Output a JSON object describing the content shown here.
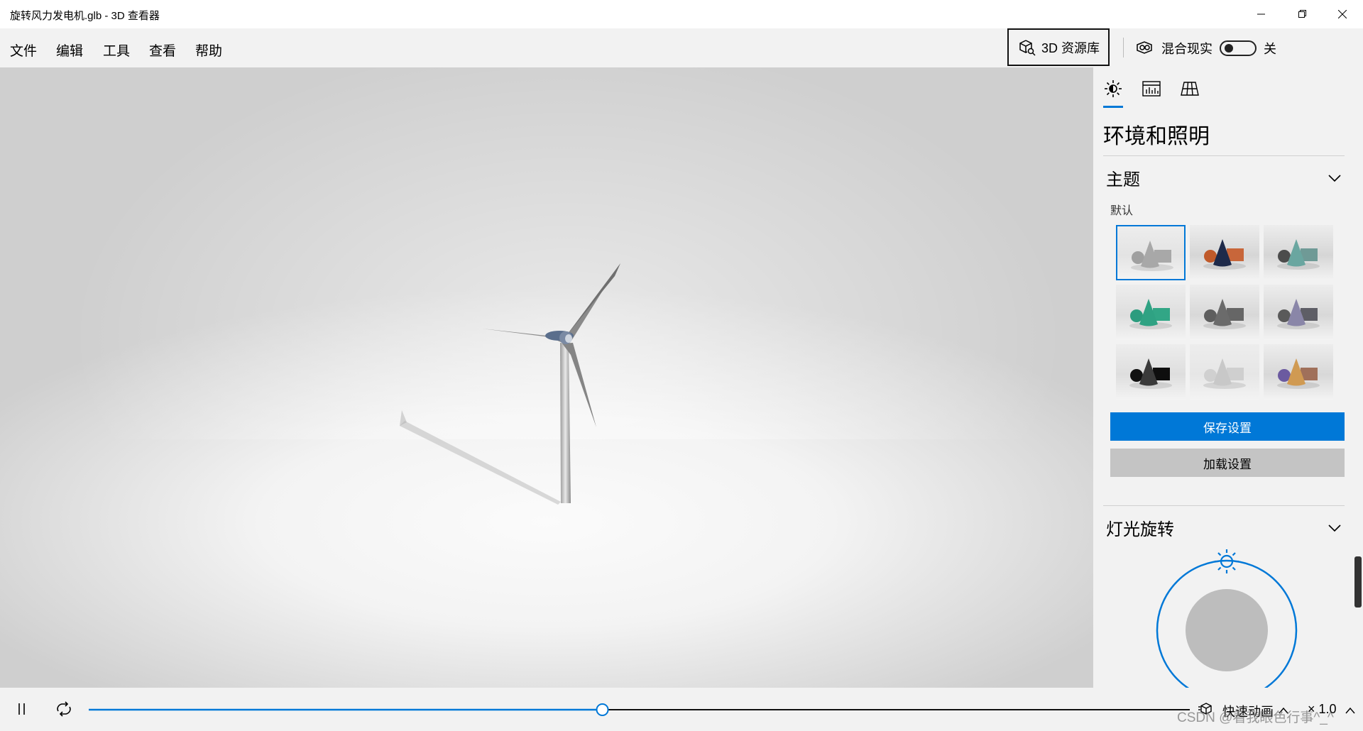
{
  "window": {
    "title": "旋转风力发电机.glb - 3D 查看器"
  },
  "menu": {
    "items": [
      "文件",
      "编辑",
      "工具",
      "查看",
      "帮助"
    ]
  },
  "toolbar": {
    "library_label": "3D 资源库",
    "mixed_reality_label": "混合现实",
    "mixed_reality_state": "关"
  },
  "panel": {
    "tabs": [
      "environment-lighting",
      "stats",
      "grid"
    ],
    "title": "环境和照明",
    "theme": {
      "heading": "主题",
      "selected_label": "默认",
      "themes": [
        {
          "cone": "#a8a8a8",
          "sphere": "#a0a0a0",
          "box": "#a8a8a8",
          "bg": "#e3e3e3",
          "selected": true
        },
        {
          "cone": "#1e2a4a",
          "sphere": "#c05a2a",
          "box": "#c8663a",
          "bg": "#d6d6d6",
          "selected": false
        },
        {
          "cone": "#6aa6a0",
          "sphere": "#4c4c4c",
          "box": "#6f9a96",
          "bg": "#d6d6d6",
          "selected": false
        },
        {
          "cone": "#2fa283",
          "sphere": "#2c9c7e",
          "box": "#32a686",
          "bg": "#dedede",
          "selected": false
        },
        {
          "cone": "#6b6b6b",
          "sphere": "#5e5e5e",
          "box": "#666666",
          "bg": "#d8d8d8",
          "selected": false
        },
        {
          "cone": "#8a86a8",
          "sphere": "#5a5a5a",
          "box": "#5e5e66",
          "bg": "#d8d8d8",
          "selected": false
        },
        {
          "cone": "#3a3a3a",
          "sphere": "#111111",
          "box": "#0e0e0e",
          "bg": "#dedede",
          "selected": false
        },
        {
          "cone": "#c8c8c8",
          "sphere": "#d0d0d0",
          "box": "#cfcfcf",
          "bg": "#e6e6e6",
          "selected": false
        },
        {
          "cone": "#d09a52",
          "sphere": "#6b5aa0",
          "box": "#a0705a",
          "bg": "#d8d8d8",
          "selected": false
        }
      ]
    },
    "save_label": "保存设置",
    "load_label": "加载设置",
    "light_rotation": {
      "heading": "灯光旋转"
    }
  },
  "playback": {
    "progress": 0.4665,
    "animation_label": "快速动画",
    "speed": "× 1.0"
  },
  "watermark": "CSDN @看我眼色行事^_^",
  "colors": {
    "accent": "#0078d7",
    "panel_bg": "#f2f2f2"
  }
}
